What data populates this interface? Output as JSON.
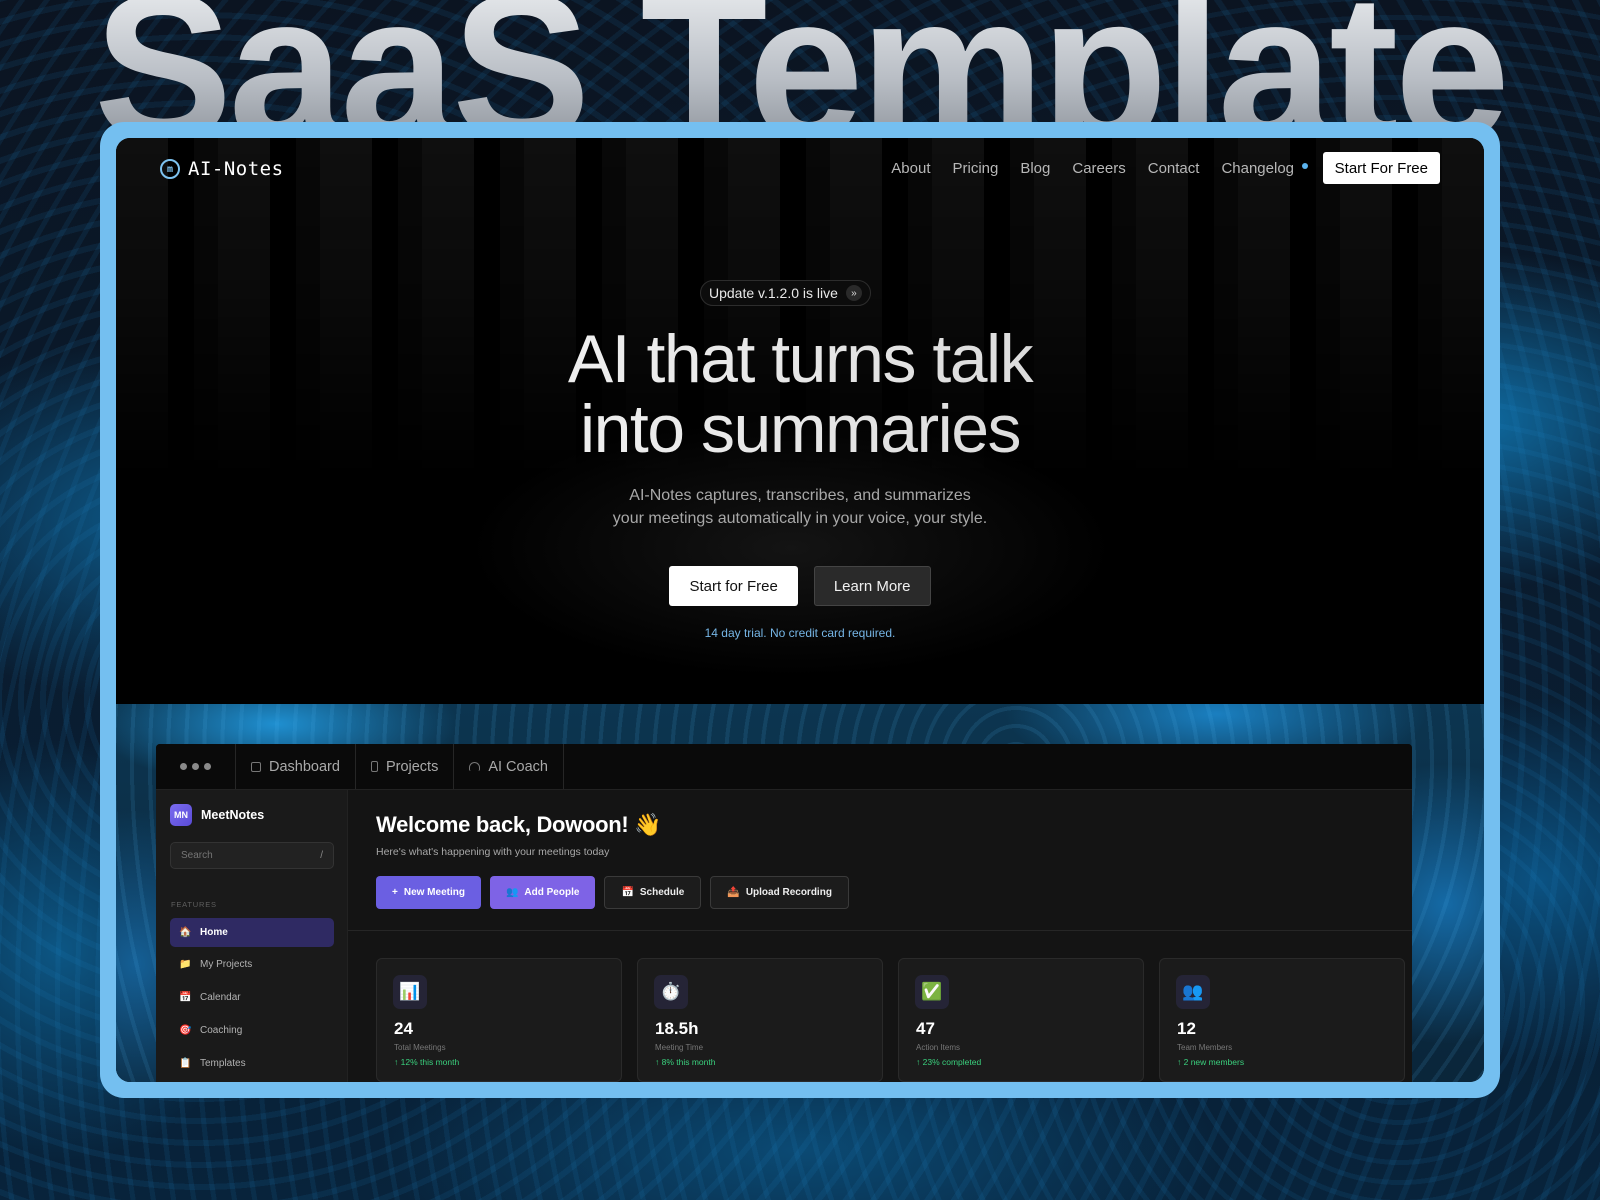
{
  "background_title": "SaaS Template",
  "site": {
    "logo_text": "AI-Notes",
    "logo_glyph": "m",
    "nav": [
      "About",
      "Pricing",
      "Blog",
      "Careers",
      "Contact",
      "Changelog"
    ],
    "nav_cta": "Start For Free"
  },
  "hero": {
    "badge": "Update v.1.2.0 is live",
    "headline_line1": "AI that turns talk",
    "headline_line2": "into summaries",
    "sub_line1": "AI-Notes captures, transcribes, and summarizes",
    "sub_line2": "your meetings automatically in your voice, your style.",
    "primary_btn": "Start for Free",
    "secondary_btn": "Learn More",
    "trial_note": "14 day trial. No credit card required."
  },
  "app": {
    "tabs": [
      "Dashboard",
      "Projects",
      "AI Coach"
    ],
    "brand_mark": "MN",
    "brand_name": "MeetNotes",
    "search_placeholder": "Search",
    "search_shortcut": "/",
    "section_label": "FEATURES",
    "sidebar": [
      {
        "emoji": "🏠",
        "label": "Home",
        "active": true
      },
      {
        "emoji": "📁",
        "label": "My Projects",
        "active": false
      },
      {
        "emoji": "📅",
        "label": "Calendar",
        "active": false
      },
      {
        "emoji": "🎯",
        "label": "Coaching",
        "active": false
      },
      {
        "emoji": "📋",
        "label": "Templates",
        "active": false
      }
    ],
    "welcome": "Welcome back, Dowoon! 👋",
    "welcome_sub": "Here's what's happening with your meetings today",
    "actions": [
      {
        "icon": "+",
        "label": "New Meeting"
      },
      {
        "icon": "👥",
        "label": "Add People"
      },
      {
        "icon": "📅",
        "label": "Schedule"
      },
      {
        "icon": "📤",
        "label": "Upload Recording"
      }
    ],
    "stats": [
      {
        "icon": "📊",
        "value": "24",
        "label": "Total Meetings",
        "trend": "↑ 12% this month"
      },
      {
        "icon": "⏱️",
        "value": "18.5h",
        "label": "Meeting Time",
        "trend": "↑ 8% this month"
      },
      {
        "icon": "✅",
        "value": "47",
        "label": "Action Items",
        "trend": "↑ 23% completed"
      },
      {
        "icon": "👥",
        "value": "12",
        "label": "Team Members",
        "trend": "↑ 2 new members"
      }
    ]
  },
  "colors": {
    "frame": "#74bff0",
    "accent_blue": "#76b6e6",
    "purple": "#6b5fe2",
    "trend_green": "#3ad07d"
  }
}
